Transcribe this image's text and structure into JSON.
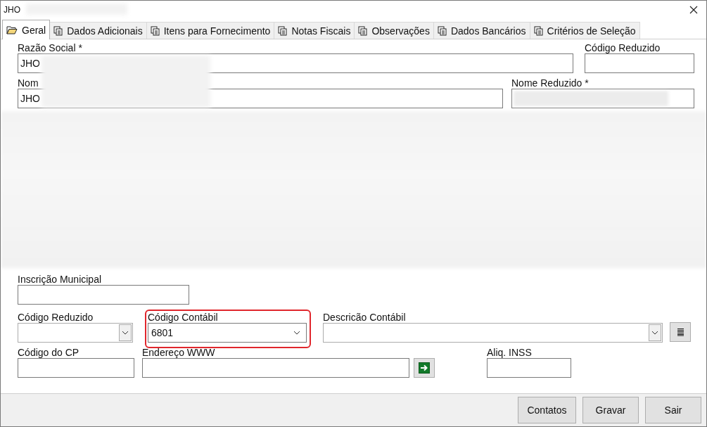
{
  "window": {
    "title": "JHO"
  },
  "tabs": [
    {
      "label": "Geral",
      "selected": true,
      "kind": "folder"
    },
    {
      "label": "Dados Adicionais",
      "selected": false,
      "kind": "pages"
    },
    {
      "label": "Itens para Fornecimento",
      "selected": false,
      "kind": "pages"
    },
    {
      "label": "Notas Fiscais",
      "selected": false,
      "kind": "pages"
    },
    {
      "label": "Observações",
      "selected": false,
      "kind": "pages"
    },
    {
      "label": "Dados Bancários",
      "selected": false,
      "kind": "pages"
    },
    {
      "label": "Critérios de Seleção",
      "selected": false,
      "kind": "pages"
    }
  ],
  "form": {
    "rows": [
      [
        {
          "label": "Razão Social *",
          "value": "JHO",
          "kind": "text"
        },
        {
          "label": "Código Reduzido",
          "kind": "text"
        }
      ],
      [
        {
          "label": "Nom",
          "value": "JHO",
          "kind": "text"
        },
        {
          "label": "Nome Reduzido *",
          "kind": "text",
          "obscured": true
        }
      ],
      [
        {
          "label": "Inscrição Municipal",
          "kind": "text"
        }
      ],
      [
        {
          "label": "Código Reduzido",
          "kind": "select"
        },
        {
          "label": "Código Contábil",
          "value": "6801",
          "kind": "select",
          "highlighted": true
        },
        {
          "label": "Descricão Contábil",
          "kind": "select"
        },
        {
          "kind": "list-button"
        }
      ],
      [
        {
          "label": "Código do CP",
          "kind": "text"
        },
        {
          "label": "Endereço WWW",
          "kind": "text"
        },
        {
          "kind": "go-button"
        },
        {
          "label": "Aliq. INSS",
          "kind": "text"
        }
      ]
    ]
  },
  "buttons": [
    "Contatos",
    "Gravar",
    "Sair"
  ]
}
